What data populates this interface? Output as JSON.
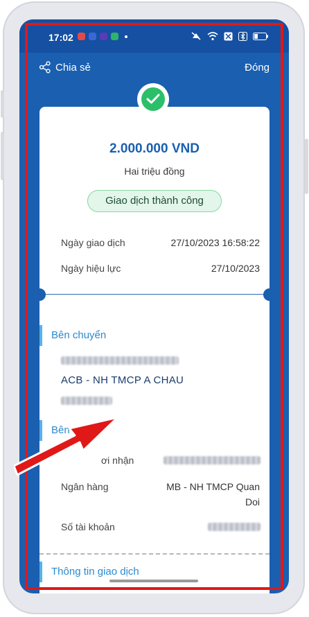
{
  "statusbar": {
    "time": "17:02",
    "app_icons": [
      "mail-icon",
      "app-icon",
      "app-icon",
      "shield-icon"
    ],
    "status_icons": [
      "mute-icon",
      "wifi-icon",
      "sim-icon",
      "bluetooth-icon",
      "battery-icon"
    ]
  },
  "topbar": {
    "share_label": "Chia sẻ",
    "close_label": "Đóng"
  },
  "receipt": {
    "amount": "2.000.000 VND",
    "amount_words": "Hai triệu đồng",
    "status": "Giao dịch thành công",
    "rows": [
      {
        "label": "Ngày giao dịch",
        "value": "27/10/2023 16:58:22"
      },
      {
        "label": "Ngày hiệu lực",
        "value": "27/10/2023"
      }
    ]
  },
  "sender": {
    "title": "Bên chuyển",
    "bank": "ACB - NH TMCP A CHAU"
  },
  "receiver": {
    "title": "Bên nhận",
    "name_label_partial": "ơi nhận",
    "bank_label": "Ngân hàng",
    "bank_value_line1": "MB - NH TMCP Quan",
    "bank_value_line2": "Doi",
    "account_label": "Số tài khoản"
  },
  "transaction": {
    "title": "Thông tin giao dịch"
  },
  "colors": {
    "primary": "#1a5fb0",
    "success": "#2bbf6a",
    "annotation_red": "#e01818",
    "section_blue": "#2a8ad0"
  }
}
